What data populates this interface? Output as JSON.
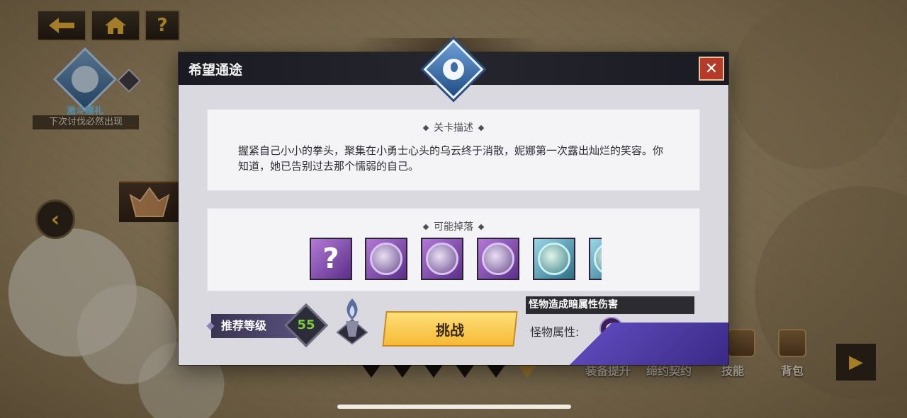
{
  "nav": {
    "back_icon": "back-arrow-icon",
    "home_icon": "home-icon",
    "help_label": "?"
  },
  "map": {
    "event_label": "激斗赠礼",
    "event_sub": "下次讨伐必然出现"
  },
  "bottom_menu": {
    "items": [
      "装备提升",
      "缔约契约",
      "技能",
      "背包"
    ]
  },
  "dialog": {
    "title": "希望通途",
    "close_label": "✕",
    "description_header": "关卡描述",
    "description_text": "握紧自己小小的拳头，聚集在小勇士心头的乌云终于消散，妮娜第一次露出灿烂的笑容。你知道，她已告别过去那个懦弱的自己。",
    "drops_header": "可能掉落",
    "drops": [
      {
        "type": "unknown",
        "label": "?"
      },
      {
        "type": "purple"
      },
      {
        "type": "purple"
      },
      {
        "type": "purple"
      },
      {
        "type": "blue"
      },
      {
        "type": "blue"
      }
    ],
    "recommend_label": "推荐等级",
    "recommend_level": "55",
    "challenge_label": "挑战",
    "monster_damage": "怪物造成暗属性伤害",
    "monster_attr_label": "怪物属性:",
    "monster_attr_icon": "dark-attribute-icon"
  },
  "colors": {
    "accent_gold": "#f6b936",
    "level_green": "#7cc93a",
    "dark_attr": "#3b1f58"
  }
}
